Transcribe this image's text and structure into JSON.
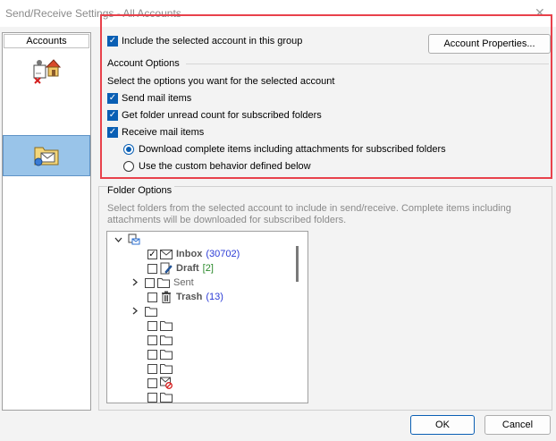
{
  "window": {
    "title": "Send/Receive Settings - All Accounts"
  },
  "accounts": {
    "header": "Accounts"
  },
  "include": {
    "label": "Include the selected account in this group",
    "checked": true
  },
  "buttons": {
    "account_properties": "Account Properties...",
    "ok": "OK",
    "cancel": "Cancel"
  },
  "account_options": {
    "title": "Account Options",
    "subtitle": "Select the options you want for the selected account",
    "send": "Send mail items",
    "folder_unread": "Get folder unread count for subscribed folders",
    "receive": "Receive mail items",
    "download_complete": "Download complete items including attachments for subscribed folders",
    "custom_behavior": "Use the custom behavior defined below"
  },
  "folder_options": {
    "title": "Folder Options",
    "description": "Select folders from the selected account to include in send/receive. Complete items including attachments will be downloaded for subscribed folders."
  },
  "tree": {
    "inbox": {
      "name": "Inbox",
      "count": "(30702)"
    },
    "draft": {
      "name": "Draft",
      "count": "[2]"
    },
    "sent": {
      "name": "Sent"
    },
    "trash": {
      "name": "Trash",
      "count": "(13)"
    }
  },
  "colors": {
    "accent": "#0a5fb4",
    "highlight": "#e8414b",
    "selection": "#99c4e9"
  }
}
